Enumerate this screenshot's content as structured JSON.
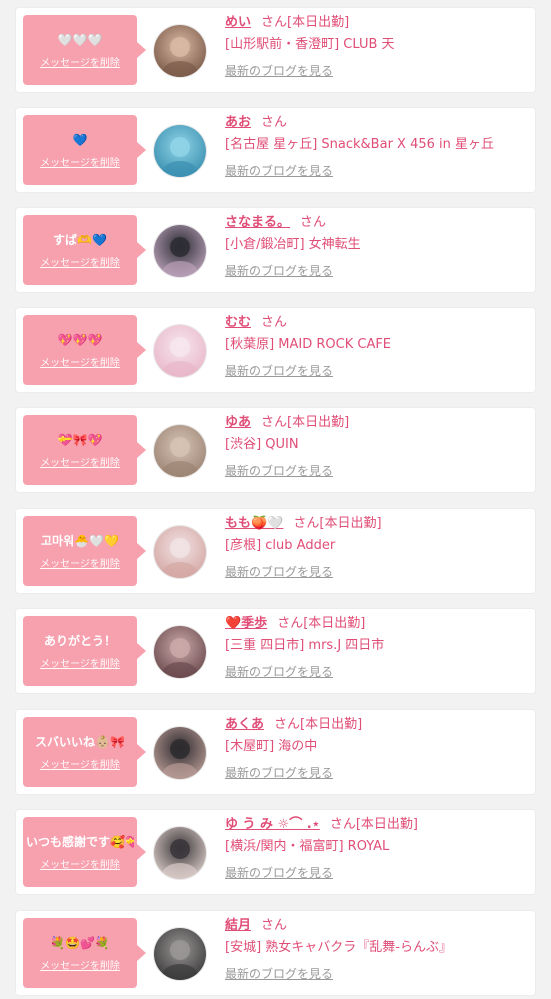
{
  "delete_label": "メッセージを削除",
  "honorific": "さん",
  "blog_label": "最新のブログを見る",
  "colors": {
    "bubble": "#f7a0ae",
    "accent": "#e04d77",
    "muted": "#9a9a9a"
  },
  "icons": {
    "avatar": "avatar-photo-icon"
  },
  "messages": [
    {
      "message": "🤍🤍🤍",
      "name": "めい",
      "status": "[本日出勤]",
      "shop": "[山形駅前・香澄町] CLUB 天"
    },
    {
      "message": "💙",
      "name": "あお",
      "status": "",
      "shop": "[名古屋 星ヶ丘] Snack&Bar X 456 in 星ヶ丘"
    },
    {
      "message": "すば🫶💙",
      "name": "さなまる。",
      "status": "",
      "shop": "[小倉/鍛冶町] 女神転生"
    },
    {
      "message": "💖💖💖",
      "name": "むむ",
      "status": "",
      "shop": "[秋葉原] MAID ROCK CAFE"
    },
    {
      "message": "💝🎀💖",
      "name": "ゆあ",
      "status": "[本日出勤]",
      "shop": "[渋谷] QUIN"
    },
    {
      "message": "고마워🐣🤍💛",
      "name": "もも🍑🤍",
      "status": "[本日出勤]",
      "shop": "[彦根] club Adder"
    },
    {
      "message": "ありがとう！",
      "name": "❤️季歩",
      "status": "[本日出勤]",
      "shop": "[三重 四日市] mrs.J 四日市"
    },
    {
      "message": "スバいいね👶🏼🎀",
      "name": "あくあ",
      "status": "[本日出勤]",
      "shop": "[木屋町] 海の中"
    },
    {
      "message": "いつも感謝です🥰💝",
      "name": "ゆ う み ☼⌒ .⋆",
      "status": "[本日出勤]",
      "shop": "[横浜/関内・福富町] ROYAL"
    },
    {
      "message": "💐🤩💕💐",
      "name": "結月",
      "status": "",
      "shop": "[安城] 熟女キャバクラ『乱舞-らんぶ』"
    }
  ]
}
